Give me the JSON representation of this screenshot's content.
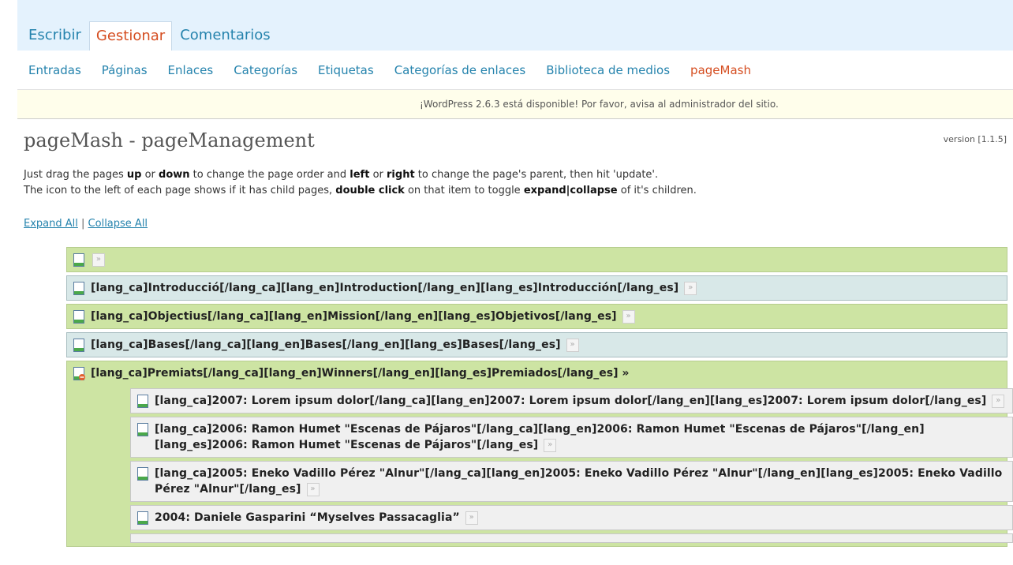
{
  "tabs": [
    {
      "label": "Escribir",
      "active": false
    },
    {
      "label": "Gestionar",
      "active": true
    },
    {
      "label": "Comentarios",
      "active": false
    }
  ],
  "submenu": [
    {
      "label": "Entradas",
      "current": false
    },
    {
      "label": "Páginas",
      "current": false
    },
    {
      "label": "Enlaces",
      "current": false
    },
    {
      "label": "Categorías",
      "current": false
    },
    {
      "label": "Etiquetas",
      "current": false
    },
    {
      "label": "Categorías de enlaces",
      "current": false
    },
    {
      "label": "Biblioteca de medios",
      "current": false
    },
    {
      "label": "pageMash",
      "current": true
    }
  ],
  "nag": "¡WordPress 2.6.3 está disponible! Por favor, avisa al administrador del sitio.",
  "title": "pageMash - pageManagement",
  "version": "version [1.1.5]",
  "instructions": {
    "line1": [
      "Just drag the pages ",
      "up",
      " or ",
      "down",
      " to change the page order and ",
      "left",
      " or ",
      "right",
      " to change the page's parent, then hit 'update'."
    ],
    "line2": [
      "The icon to the left of each page shows if it has child pages, ",
      "double click",
      " on that item to toggle ",
      "expand|collapse",
      " of it's children."
    ]
  },
  "expand_links": {
    "expand": "Expand All",
    "separator": "|",
    "collapse": "Collapse All"
  },
  "expand_glyph": "»",
  "pages": [
    {
      "title": "",
      "color": "green"
    },
    {
      "title": "[lang_ca]Introducció[/lang_ca][lang_en]Introduction[/lang_en][lang_es]Introducción[/lang_es]",
      "color": "blue"
    },
    {
      "title": "[lang_ca]Objectius[/lang_ca][lang_en]Mission[/lang_en][lang_es]Objetivos[/lang_es]",
      "color": "green"
    },
    {
      "title": "[lang_ca]Bases[/lang_ca][lang_en]Bases[/lang_en][lang_es]Bases[/lang_es]",
      "color": "blue"
    }
  ],
  "parent_page": {
    "title": "[lang_ca]Premiats[/lang_ca][lang_en]Winners[/lang_en][lang_es]Premiados[/lang_es]",
    "children": [
      {
        "title": "[lang_ca]2007: Lorem ipsum dolor[/lang_ca][lang_en]2007: Lorem ipsum dolor[/lang_en][lang_es]2007: Lorem ipsum dolor[/lang_es]"
      },
      {
        "title": "[lang_ca]2006: Ramon Humet \"Escenas de Pájaros\"[/lang_ca][lang_en]2006: Ramon Humet \"Escenas de Pájaros\"[/lang_en][lang_es]2006: Ramon Humet \"Escenas de Pájaros\"[/lang_es]"
      },
      {
        "title": "[lang_ca]2005: Eneko Vadillo Pérez \"Alnur\"[/lang_ca][lang_en]2005: Eneko Vadillo Pérez \"Alnur\"[/lang_en][lang_es]2005: Eneko Vadillo Pérez \"Alnur\"[/lang_es]"
      },
      {
        "title": "2004: Daniele Gasparini “Myselves Passacaglia”"
      }
    ]
  }
}
